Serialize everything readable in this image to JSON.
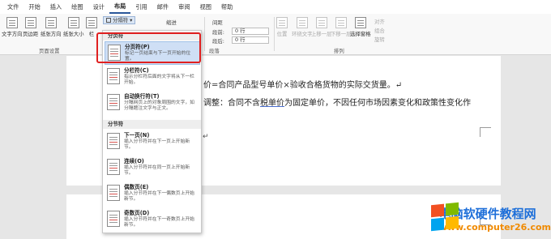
{
  "menu_tabs": [
    "文件",
    "开始",
    "插入",
    "绘图",
    "设计",
    "布局",
    "引用",
    "邮件",
    "审阅",
    "视图",
    "帮助"
  ],
  "active_tab": "布局",
  "ribbon": {
    "text_direction": "文字方向",
    "margins": "页边距",
    "orientation": "纸张方向",
    "size": "纸张大小",
    "columns": "栏",
    "breaks_button": "分隔符",
    "indent_label": "缩进",
    "spacing_label": "间距",
    "spacing_before_label": "段前:",
    "spacing_before_value": "0 行",
    "spacing_after_label": "段后:",
    "spacing_after_value": "0 行",
    "page_setup_group": "页面设置",
    "paragraph_group": "段落",
    "arrange_group": "排列",
    "position": "位置",
    "wrap_text": "环绕文字",
    "bring_forward": "上移一层",
    "send_backward": "下移一层",
    "selection_pane": "选择窗格",
    "align": "对齐",
    "group": "组合",
    "rotate": "旋转"
  },
  "breaks_menu": {
    "page_breaks_header": "分页符",
    "section_breaks_header": "分节符",
    "items": [
      {
        "title": "分页符(P)",
        "desc": "标记一页结束与下一页开始的位置。"
      },
      {
        "title": "分栏符(C)",
        "desc": "指示分栏符后面的文字将从下一栏开始。"
      },
      {
        "title": "自动换行符(T)",
        "desc": "分隔网页上的对象周围的文字，如分隔题注文字与正文。"
      },
      {
        "title": "下一页(N)",
        "desc": "插入分节符并在下一页上开始新节。"
      },
      {
        "title": "连续(O)",
        "desc": "插入分节符并在同一页上开始新节。"
      },
      {
        "title": "偶数页(E)",
        "desc": "插入分节符并在下一偶数页上开始新节。"
      },
      {
        "title": "奇数页(D)",
        "desc": "插入分节符并在下一奇数页上开始新节。"
      }
    ]
  },
  "document": {
    "line1": "价=合同产品型号单价×验收合格货物的实际交货量。↵",
    "line2_prefix": "调整：合同不含",
    "line2_ul": "税单价",
    "line2_suffix": "为固定单价，不因任何市场因素变化和政策性变化作",
    "mark": "↵"
  },
  "watermark": {
    "title": "电脑软硬件教程网",
    "url": "www.computer26.com"
  }
}
